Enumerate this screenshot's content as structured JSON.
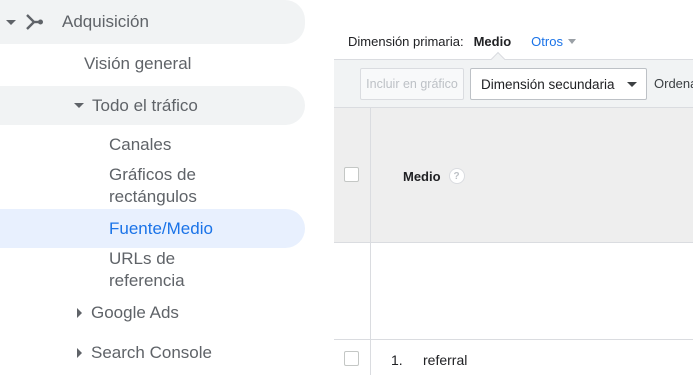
{
  "sidebar": {
    "acquisition": {
      "label": "Adquisición",
      "icon": "acquisition-branch-icon"
    },
    "overview": {
      "label": "Visión general"
    },
    "all_traffic": {
      "label": "Todo el tráfico"
    },
    "channels": {
      "label": "Canales"
    },
    "treemaps": {
      "line1": "Gráficos de",
      "line2": "rectángulos"
    },
    "source_medium": {
      "label": "Fuente/Medio"
    },
    "referrals": {
      "line1": "URLs de",
      "line2": "referencia"
    },
    "google_ads": {
      "label": "Google Ads"
    },
    "search_console": {
      "label": "Search Console"
    }
  },
  "main": {
    "primary_dimension_label": "Dimensión primaria:",
    "primary_dimension_value": "Medio",
    "others_label": "Otros",
    "toolbar": {
      "plot_button": "Incluir en gráfico",
      "secondary_dimension": "Dimensión secundaria",
      "sort_label": "Ordena"
    },
    "table": {
      "column_header": "Medio",
      "help_glyph": "?",
      "rows": [
        {
          "index": "1.",
          "value": "referral"
        }
      ]
    }
  },
  "colors": {
    "active_bg": "#e8f0fe",
    "active_text": "#1a73e8",
    "section_bg": "#f1f3f4",
    "link": "#1a73e8"
  }
}
